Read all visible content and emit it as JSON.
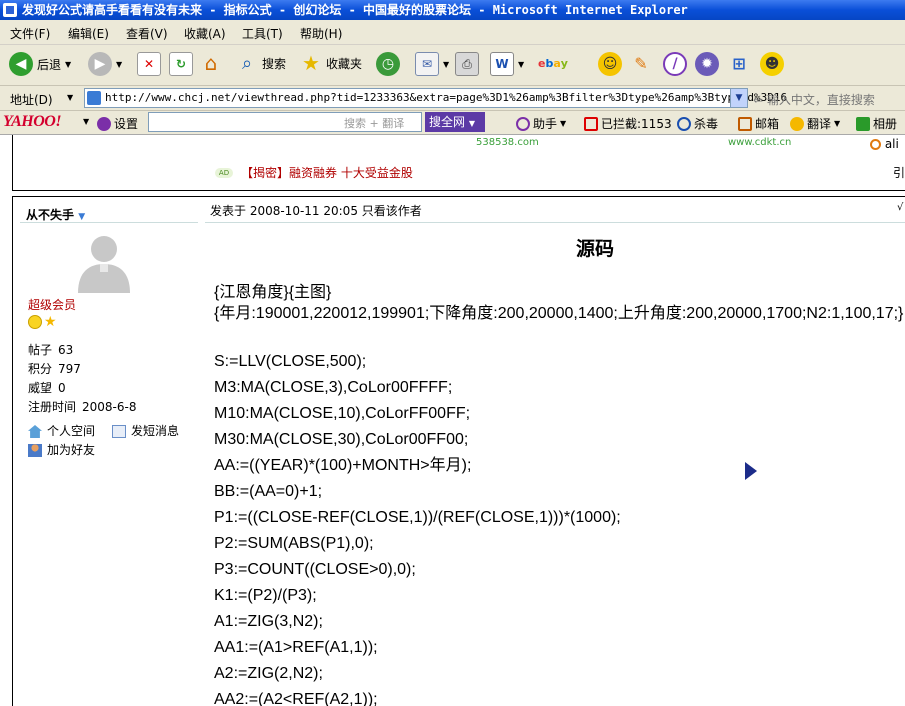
{
  "window": {
    "title": "发现好公式请高手看看有没有未来 - 指标公式 - 创幻论坛 - 中国最好的股票论坛 - Microsoft Internet Explorer"
  },
  "menu": [
    "文件(F)",
    "编辑(E)",
    "查看(V)",
    "收藏(A)",
    "工具(T)",
    "帮助(H)"
  ],
  "toolbar": {
    "back_label": "后退",
    "search_label": "搜索",
    "favorites_label": "收藏夹"
  },
  "address": {
    "label": "地址(D)",
    "url": "http://www.chcj.net/viewthread.php?tid=1233363&extra=page%3D1%26amp%3Bfilter%3Dtype%26amp%3Btypeid%3D16",
    "search_hint": "输入中文，直接搜索"
  },
  "yahoo": {
    "logo": "YAHOO!",
    "settings": "设置",
    "search_placeholder": "搜索 + 翻译",
    "search_button": "搜全网",
    "helper": "助手",
    "blocked": "已拦截:1153",
    "antivirus": "杀毒",
    "mail": "邮箱",
    "translate": "翻译",
    "album": "相册"
  },
  "ad": {
    "site1": "538538.com",
    "site2": "www.cdkt.cn",
    "site3": "ali",
    "badge": "AD",
    "text": "【揭密】融资融券 十大受益金股",
    "right": "引"
  },
  "post": {
    "author": "从不失手",
    "time": "发表于 2008-10-11 20:05 只看该作者",
    "rank": "超级会员",
    "stats": [
      {
        "label": "帖子",
        "value": "63"
      },
      {
        "label": "积分",
        "value": "797"
      },
      {
        "label": "威望",
        "value": "0"
      },
      {
        "label": "注册时间",
        "value": "2008-6-8"
      }
    ],
    "links": {
      "space": "个人空间",
      "message": "发短消息",
      "friend": "加为好友"
    },
    "title": "源码",
    "code_header": [
      "{江恩角度}{主图}",
      "{年月:190001,220012,199901;下降角度:200,20000,1400;上升角度:200,20000,1700;N2:1,100,17;}"
    ],
    "code": [
      "S:=LLV(CLOSE,500);",
      "M3:MA(CLOSE,3),CoLor00FFFF;",
      "M10:MA(CLOSE,10),CoLorFF00FF;",
      "M30:MA(CLOSE,30),CoLor00FF00;",
      "AA:=((YEAR)*(100)+MONTH>年月);",
      "BB:=(AA=0)+1;",
      "P1:=((CLOSE-REF(CLOSE,1))/(REF(CLOSE,1)))*(1000);",
      "P2:=SUM(ABS(P1),0);",
      "P3:=COUNT((CLOSE>0),0);",
      "K1:=(P2)/(P3);",
      "A1:=ZIG(3,N2);",
      "AA1:=(A1>REF(A1,1));",
      "A2:=ZIG(2,N2);",
      "AA2:=(A2<REF(A2,1));"
    ]
  }
}
